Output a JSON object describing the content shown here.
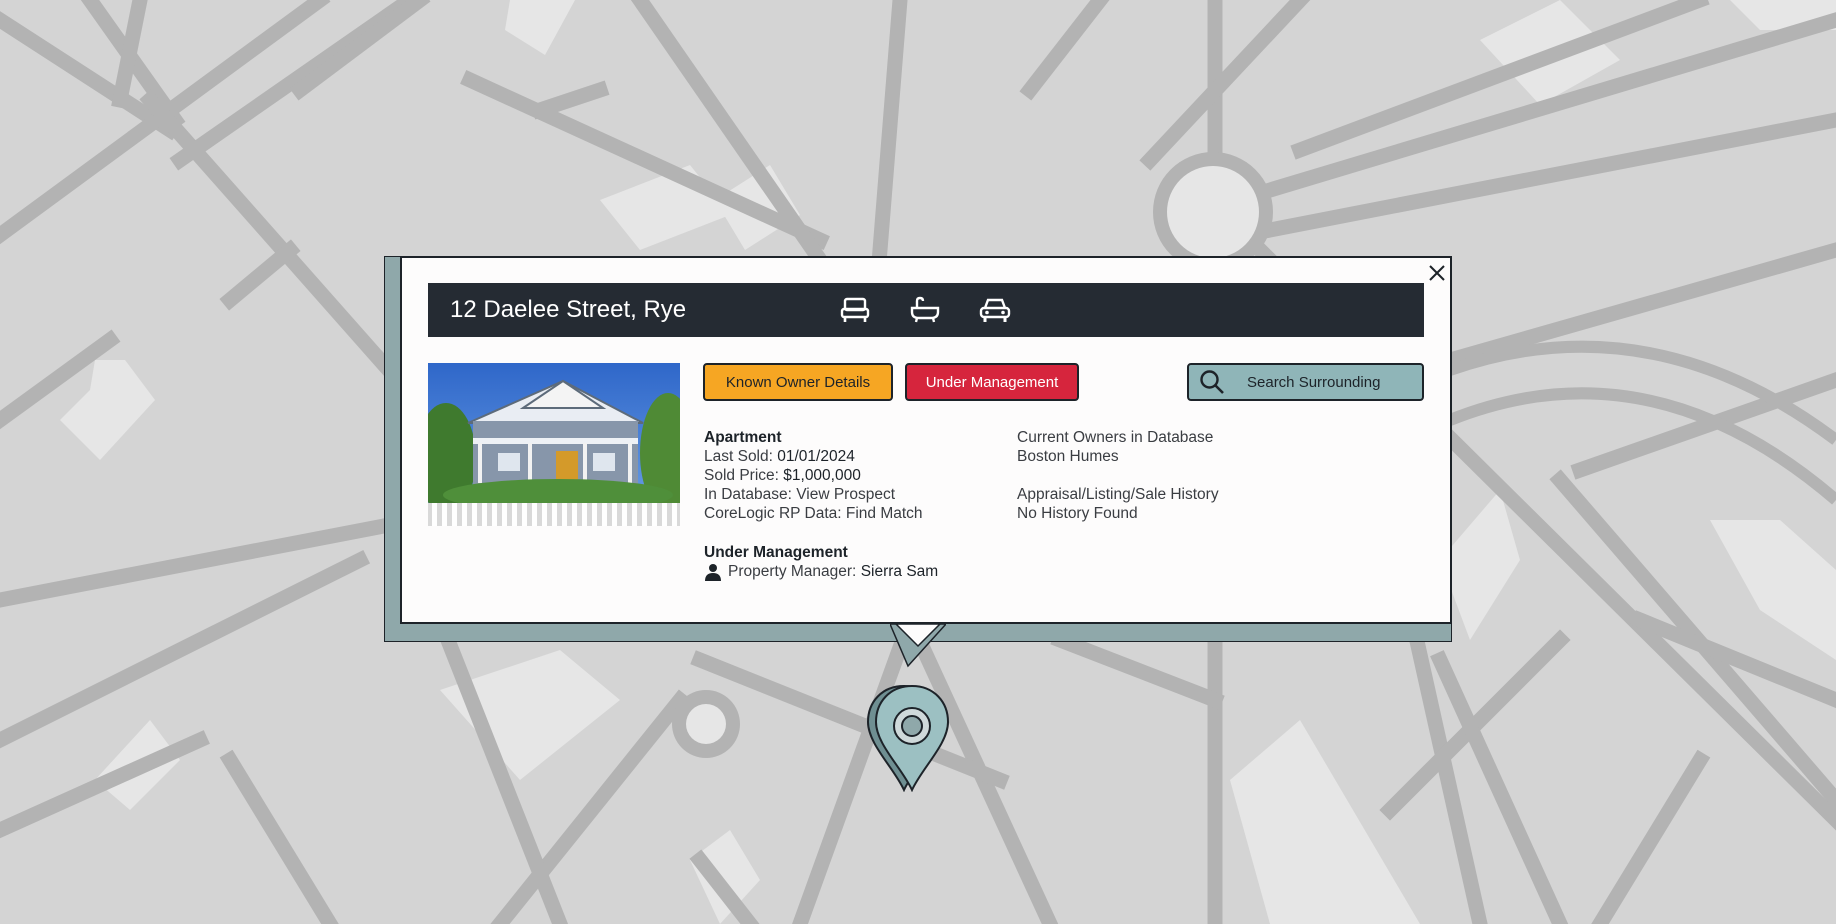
{
  "property": {
    "address": "12 Daelee Street, Rye",
    "icons": [
      "bed-icon",
      "bath-icon",
      "car-icon"
    ]
  },
  "actions": {
    "known_owner_label": "Known Owner Details",
    "under_management_label": "Under Management",
    "search_surrounding_label": "Search Surrounding"
  },
  "details": {
    "type": "Apartment",
    "last_sold_label": "Last Sold:",
    "last_sold_value": "01/01/2024",
    "sold_price_label": "Sold Price:",
    "sold_price_value": "$1,000,000",
    "in_database_label": "In Database:",
    "in_database_link": "View Prospect",
    "corelogic_label": "CoreLogic RP Data:",
    "corelogic_link": "Find Match"
  },
  "owners": {
    "heading": "Current Owners in Database",
    "name": "Boston Humes"
  },
  "history": {
    "heading": "Appraisal/Listing/Sale History",
    "value": "No History Found"
  },
  "management": {
    "heading": "Under Management",
    "manager_label": "Property Manager:",
    "manager_name": "Sierra Sam"
  },
  "colors": {
    "header_bg": "#252b33",
    "owner_button": "#f6a623",
    "management_button": "#d6253d",
    "search_button": "#8fb5b8",
    "panel_shadow": "#8fa8aa",
    "map_block": "#d4d4d4",
    "map_road": "#b3b3b3"
  }
}
